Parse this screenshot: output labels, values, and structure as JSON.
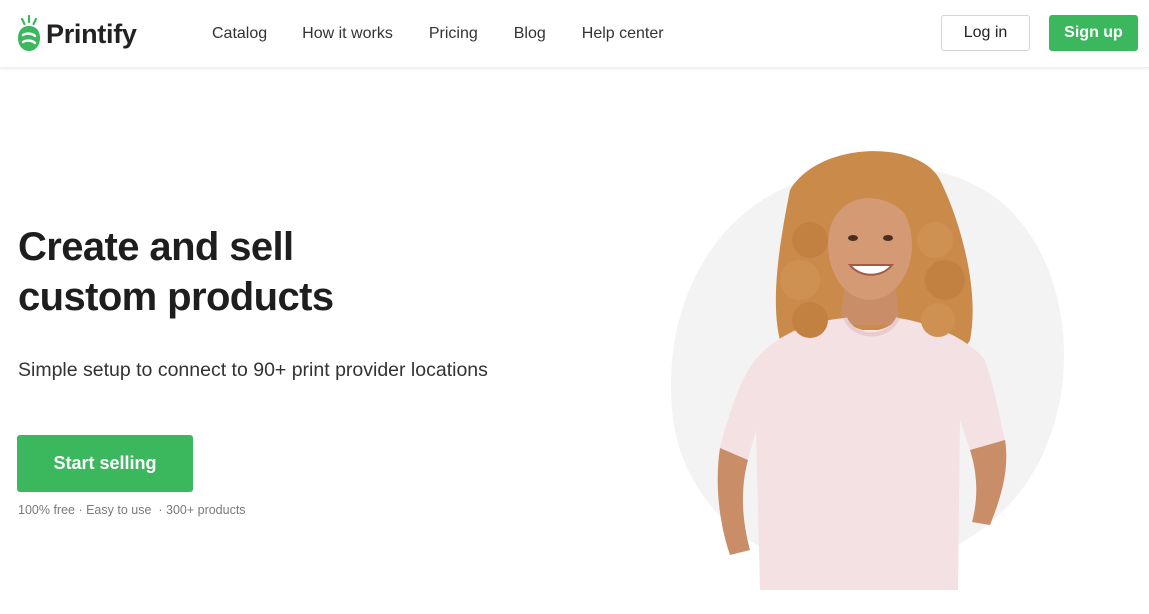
{
  "brand": {
    "name": "Printify",
    "green": "#3bb75e",
    "dark": "#1e1e1e"
  },
  "nav": {
    "items": [
      "Catalog",
      "How it works",
      "Pricing",
      "Blog",
      "Help center"
    ]
  },
  "auth": {
    "login_label": "Log in",
    "signup_label": "Sign up"
  },
  "hero": {
    "title_line1": "Create and sell",
    "title_line2": "custom products",
    "subtitle": "Simple setup to connect to 90+ print provider locations",
    "cta_label": "Start selling",
    "note": "100% free · Easy to use  · 300+ products"
  },
  "icons": {
    "logo": "printify-logo-icon",
    "hero": "model-in-tshirt-illustration"
  }
}
